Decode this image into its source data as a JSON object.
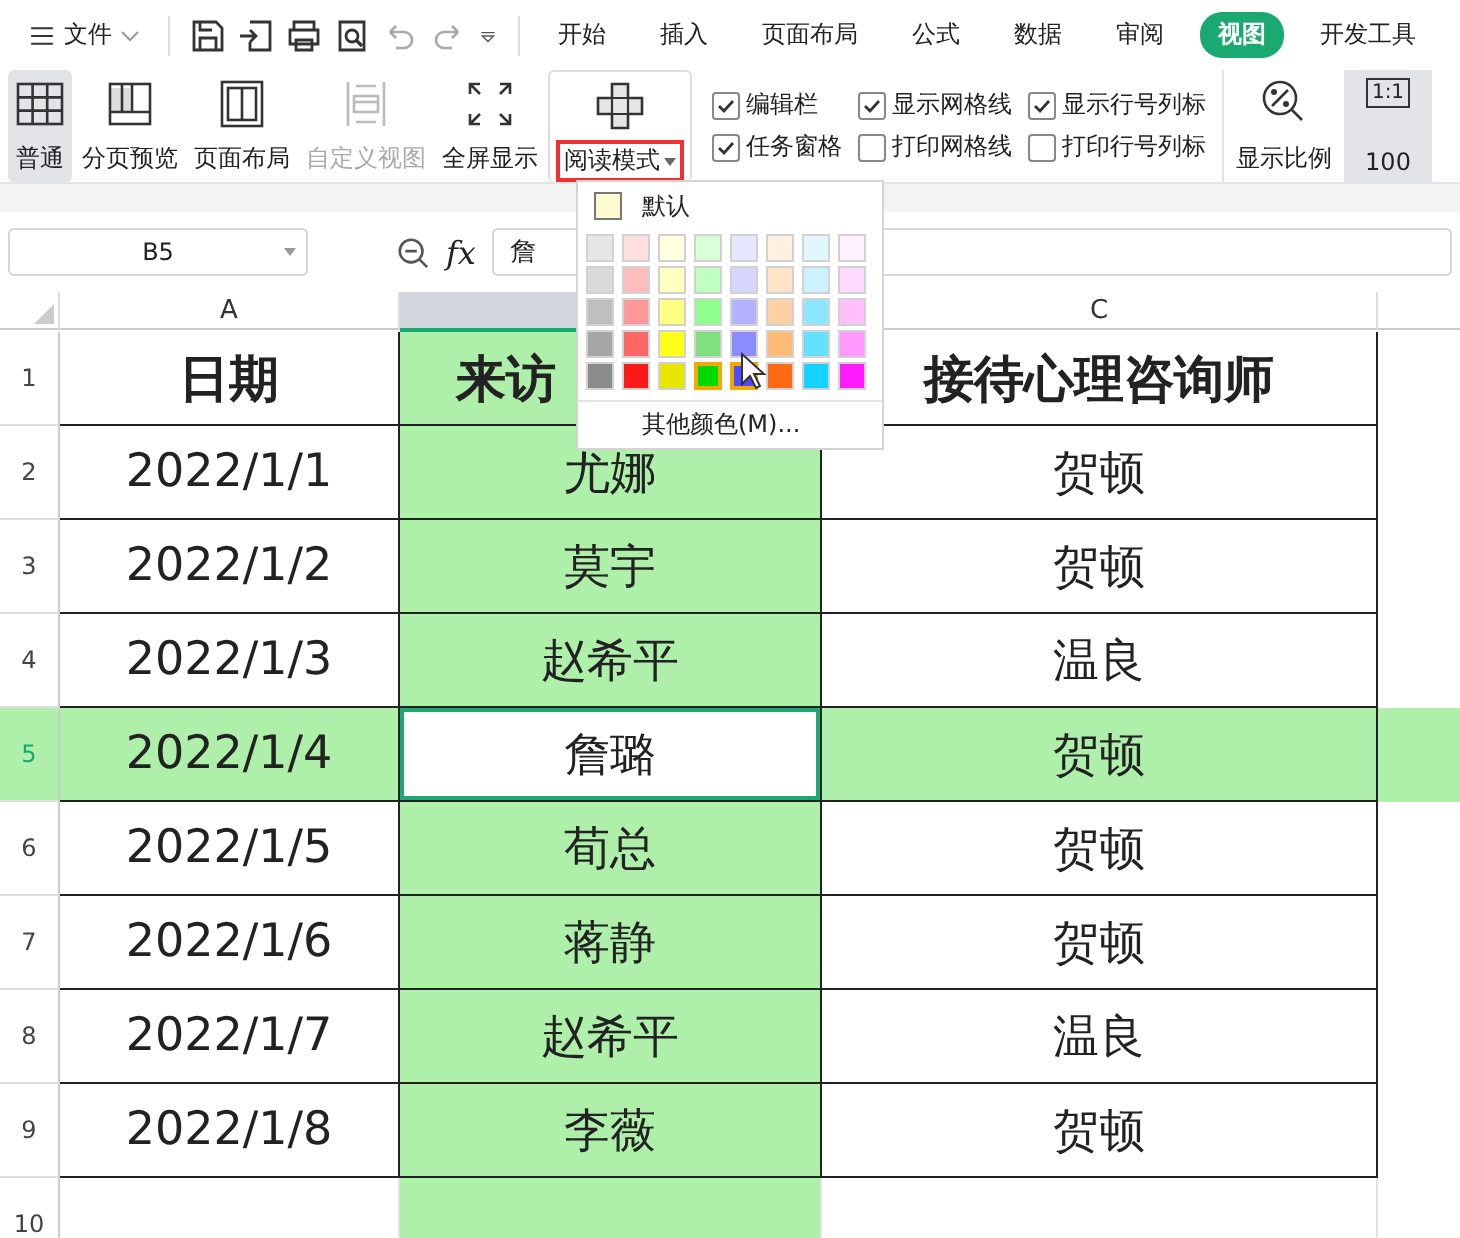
{
  "menu_bar": {
    "file": "文件",
    "tabs": [
      {
        "label": "开始",
        "selected": false
      },
      {
        "label": "插入",
        "selected": false
      },
      {
        "label": "页面布局",
        "selected": false
      },
      {
        "label": "公式",
        "selected": false
      },
      {
        "label": "数据",
        "selected": false
      },
      {
        "label": "审阅",
        "selected": false
      },
      {
        "label": "视图",
        "selected": true
      },
      {
        "label": "开发工具",
        "selected": false
      }
    ]
  },
  "ribbon": {
    "views": [
      {
        "kind": "normal",
        "label": "普通",
        "selected": true,
        "disabled": false
      },
      {
        "kind": "pagebreak",
        "label": "分页预览",
        "selected": false,
        "disabled": false
      },
      {
        "kind": "layout",
        "label": "页面布局",
        "selected": false,
        "disabled": false
      },
      {
        "kind": "custom",
        "label": "自定义视图",
        "selected": false,
        "disabled": true
      },
      {
        "kind": "fullscreen",
        "label": "全屏显示",
        "selected": false,
        "disabled": false
      },
      {
        "kind": "reading",
        "label": "阅读模式",
        "selected": false,
        "disabled": false
      }
    ],
    "checkboxes": [
      {
        "label": "编辑栏",
        "checked": true
      },
      {
        "label": "显示网格线",
        "checked": true
      },
      {
        "label": "显示行号列标",
        "checked": true
      },
      {
        "label": "任务窗格",
        "checked": true
      },
      {
        "label": "打印网格线",
        "checked": false
      },
      {
        "label": "打印行号列标",
        "checked": false
      }
    ],
    "zoom": "显示比例",
    "actual_size": {
      "icon": "1:1",
      "label": "100"
    }
  },
  "formula_bar": {
    "cell_ref": "B5",
    "fx": "fx",
    "value": "詹"
  },
  "sheet": {
    "columns": [
      {
        "label": "A",
        "selected": false
      },
      {
        "selected": true
      },
      {
        "label": "C",
        "selected": false
      }
    ],
    "rows": [
      {
        "number": "1",
        "selected": false,
        "header": true,
        "cells": [
          "日期",
          "来访",
          "接待心理咨询师"
        ]
      },
      {
        "number": "2",
        "selected": false,
        "cells": [
          "2022/1/1",
          "尤娜",
          "贺顿"
        ]
      },
      {
        "number": "3",
        "selected": false,
        "cells": [
          "2022/1/2",
          "莫宇",
          "贺顿"
        ]
      },
      {
        "number": "4",
        "selected": false,
        "cells": [
          "2022/1/3",
          "赵希平",
          "温良"
        ]
      },
      {
        "number": "5",
        "selected": true,
        "cells": [
          "2022/1/4",
          "詹璐",
          "贺顿"
        ]
      },
      {
        "number": "6",
        "selected": false,
        "cells": [
          "2022/1/5",
          "荀总",
          "贺顿"
        ]
      },
      {
        "number": "7",
        "selected": false,
        "cells": [
          "2022/1/6",
          "蒋静",
          "贺顿"
        ]
      },
      {
        "number": "8",
        "selected": false,
        "cells": [
          "2022/1/7",
          "赵希平",
          "温良"
        ]
      },
      {
        "number": "9",
        "selected": false,
        "cells": [
          "2022/1/8",
          "李薇",
          "贺顿"
        ]
      },
      {
        "number": "10",
        "selected": false
      }
    ]
  },
  "color_menu": {
    "default": "默认",
    "more": "其他颜色(M)...",
    "rows": [
      [
        {
          "color": "#e6e6e6",
          "selected": false
        },
        {
          "color": "#ffdede",
          "selected": false
        },
        {
          "color": "#ffffe0",
          "selected": false
        },
        {
          "color": "#d9ffd9",
          "selected": false
        },
        {
          "color": "#e6e6ff",
          "selected": false
        },
        {
          "color": "#fff0e0",
          "selected": false
        },
        {
          "color": "#e0f7ff",
          "selected": false
        },
        {
          "color": "#fff0ff",
          "selected": false
        }
      ],
      [
        {
          "color": "#d9d9d9",
          "selected": false
        },
        {
          "color": "#ffbcbc",
          "selected": false
        },
        {
          "color": "#ffffc0",
          "selected": false
        },
        {
          "color": "#bfffbf",
          "selected": false
        },
        {
          "color": "#d6d6ff",
          "selected": false
        },
        {
          "color": "#ffe3c8",
          "selected": false
        },
        {
          "color": "#ccf2ff",
          "selected": false
        },
        {
          "color": "#ffd9ff",
          "selected": false
        }
      ],
      [
        {
          "color": "#bfbfbf",
          "selected": false
        },
        {
          "color": "#ff9999",
          "selected": false
        },
        {
          "color": "#ffff80",
          "selected": false
        },
        {
          "color": "#8cff8c",
          "selected": false
        },
        {
          "color": "#b3b3ff",
          "selected": false
        },
        {
          "color": "#ffd0a6",
          "selected": false
        },
        {
          "color": "#8ce6ff",
          "selected": false
        },
        {
          "color": "#ffbfff",
          "selected": false
        }
      ],
      [
        {
          "color": "#a6a6a6",
          "selected": false
        },
        {
          "color": "#ff6666",
          "selected": false
        },
        {
          "color": "#ffff1a",
          "selected": false
        },
        {
          "color": "#80e080",
          "selected": false
        },
        {
          "color": "#8c8cff",
          "selected": false
        },
        {
          "color": "#ffbb77",
          "selected": false
        },
        {
          "color": "#66e0ff",
          "selected": false
        },
        {
          "color": "#ff99ff",
          "selected": false
        }
      ],
      [
        {
          "color": "#8c8c8c",
          "selected": false
        },
        {
          "color": "#ff1a1a",
          "selected": false
        },
        {
          "color": "#e6e600",
          "selected": false
        },
        {
          "color": "#00d900",
          "selected": true
        },
        {
          "color": "#4d4dff",
          "selected": true
        },
        {
          "color": "#ff6a13",
          "selected": false
        },
        {
          "color": "#16d2ff",
          "selected": false
        },
        {
          "color": "#ff1aff",
          "selected": false
        }
      ]
    ]
  }
}
